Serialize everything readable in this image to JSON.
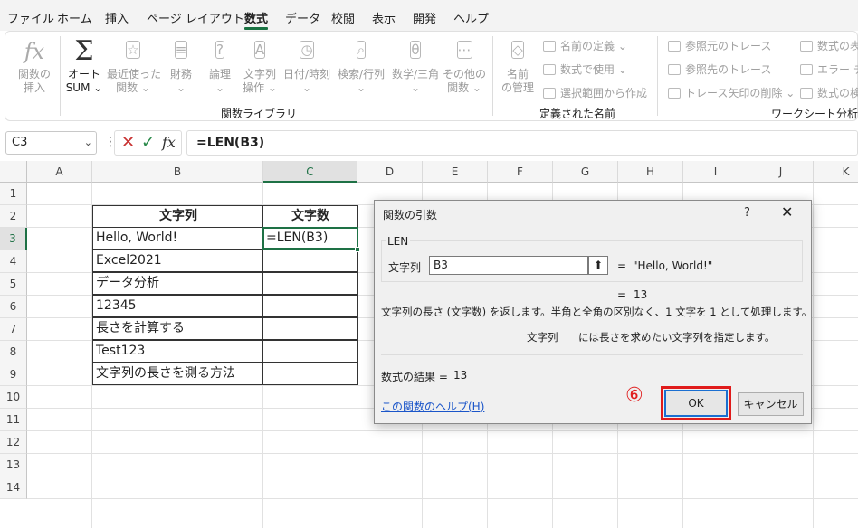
{
  "menu": {
    "tabs": [
      "ファイル",
      "ホーム",
      "挿入",
      "ページ レイアウト",
      "数式",
      "データ",
      "校閲",
      "表示",
      "開発",
      "ヘルプ"
    ],
    "active_tab": "数式"
  },
  "ribbon": {
    "insert_fn": [
      "関数の",
      "挿入"
    ],
    "autosum": [
      "オート",
      "SUM ⌄"
    ],
    "recent": [
      "最近使った",
      "関数 ⌄"
    ],
    "financial": [
      "財務",
      "⌄"
    ],
    "logical": [
      "論理",
      "⌄"
    ],
    "text": [
      "文字列",
      "操作 ⌄"
    ],
    "datetime": [
      "日付/時刻",
      "⌄"
    ],
    "lookup": [
      "検索/行列",
      "⌄"
    ],
    "math": [
      "数学/三角",
      "⌄"
    ],
    "other": [
      "その他の",
      "関数 ⌄"
    ],
    "library_label": "関数ライブラリ",
    "name_manager": [
      "名前",
      "の管理"
    ],
    "define_name": "名前の定義 ⌄",
    "use_in_formula": "数式で使用 ⌄",
    "create_from_selection": "選択範囲から作成",
    "defined_names_label": "定義された名前",
    "trace_precedents": "参照元のトレース",
    "trace_dependents": "参照先のトレース",
    "remove_arrows": "トレース矢印の削除 ⌄",
    "show_formulas": "数式の表",
    "error_check": "エラー チェ",
    "evaluate": "数式の検",
    "audit_label": "ワークシート分析"
  },
  "formula_bar": {
    "name_box": "C3",
    "formula": "=LEN(B3)"
  },
  "grid": {
    "columns": [
      "A",
      "B",
      "C",
      "D",
      "E",
      "F",
      "G",
      "H",
      "I",
      "J",
      "K"
    ],
    "rows": [
      "1",
      "2",
      "3",
      "4",
      "5",
      "6",
      "7",
      "8",
      "9",
      "10",
      "11",
      "12",
      "13",
      "14"
    ],
    "table_headers": [
      "文字列",
      "文字数"
    ],
    "table_rows": [
      "Hello, World!",
      "Excel2021",
      "データ分析",
      "12345",
      "長さを計算する",
      "Test123",
      "文字列の長さを測る方法"
    ],
    "active_cell_text": "=LEN(B3)"
  },
  "dialog": {
    "title": "関数の引数",
    "help": "?",
    "close": "✕",
    "function_name": "LEN",
    "arg_label": "文字列",
    "arg_value": "B3",
    "ref_button": "⬆",
    "eq": "=",
    "arg_result": "\"Hello, World!\"",
    "result_preview": "13",
    "description": "文字列の長さ (文字数) を返します。半角と全角の区別なく、1 文字を 1 として処理します。",
    "arg_name": "文字列",
    "arg_description": "には長さを求めたい文字列を指定します。",
    "formula_result_label": "数式の結果 =",
    "formula_result_value": "13",
    "help_link": "この関数のヘルプ(H)",
    "annotation": "⑥",
    "ok_label": "OK",
    "cancel_label": "キャンセル"
  }
}
